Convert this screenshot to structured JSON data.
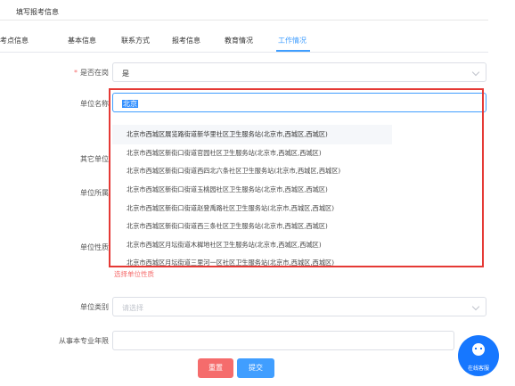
{
  "page": {
    "title": "填写报考信息"
  },
  "tabs": [
    {
      "label": "考点信息"
    },
    {
      "label": "基本信息"
    },
    {
      "label": "联系方式"
    },
    {
      "label": "报考信息"
    },
    {
      "label": "教育情况"
    },
    {
      "label": "工作情况",
      "active": true
    }
  ],
  "form": {
    "employed": {
      "label": "是否在岗",
      "value": "是",
      "required": true
    },
    "unit_name": {
      "label": "单位名称",
      "value": "北京"
    },
    "other_unit": {
      "label": "其它单位"
    },
    "unit_location": {
      "label": "单位所属"
    },
    "unit_nature": {
      "label": "单位性质",
      "error": "选择单位性质"
    },
    "unit_category": {
      "label": "单位类别",
      "placeholder": "请选择"
    },
    "years_in_profession": {
      "label": "从事本专业年限",
      "value": ""
    }
  },
  "dropdown": {
    "options": [
      "北京市西城区展览路街道新华里社区卫生服务站(北京市,西城区,西城区)",
      "北京市西城区新街口街道官园社区卫生服务站(北京市,西城区,西城区)",
      "北京市西城区新街口街道西四北六条社区卫生服务站(北京市,西城区,西城区)",
      "北京市西城区新街口街道玉桃园社区卫生服务站(北京市,西城区,西城区)",
      "北京市西城区新街口街道赵登禹路社区卫生服务站(北京市,西城区,西城区)",
      "北京市西城区新街口街道西三条社区卫生服务站(北京市,西城区,西城区)",
      "北京市西城区月坛街道木樨地社区卫生服务站(北京市,西城区,西城区)",
      "北京市西城区月坛街道三里河一区社区卫生服务站(北京市,西城区,西城区)"
    ]
  },
  "buttons": {
    "reset": "重置",
    "submit": "提交"
  },
  "chat": {
    "label": "在线客服",
    "icon": "chat-bubble-icon"
  },
  "colors": {
    "primary": "#409eff",
    "danger": "#f56c6c",
    "highlight_box": "#e53935"
  }
}
